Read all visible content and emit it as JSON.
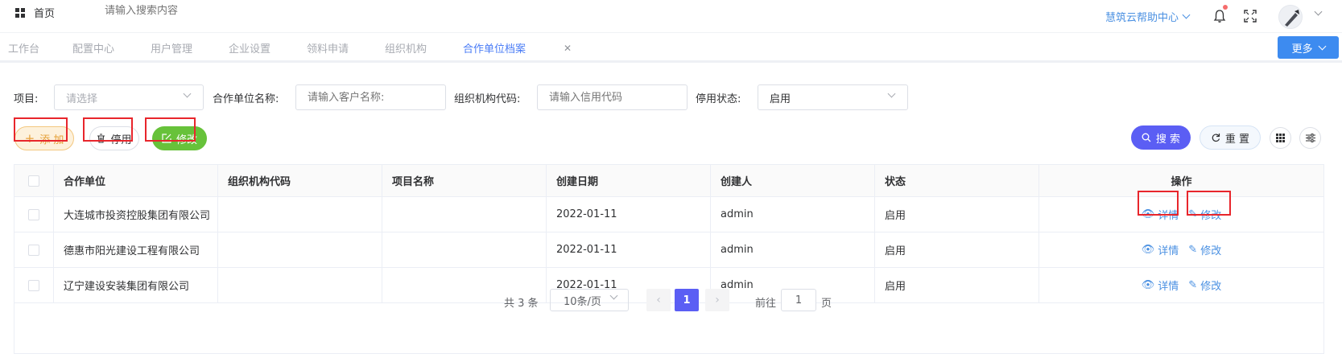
{
  "header": {
    "home_label": "首页",
    "search_placeholder": "请输入搜索内容",
    "help_center": "慧筑云帮助中心"
  },
  "tabs": [
    {
      "label": "工作台"
    },
    {
      "label": "配置中心"
    },
    {
      "label": "用户管理"
    },
    {
      "label": "企业设置"
    },
    {
      "label": "领料申请"
    },
    {
      "label": "组织机构"
    },
    {
      "label": "合作单位档案",
      "active": true
    }
  ],
  "more_label": "更多",
  "filters": {
    "project_label": "项目:",
    "project_placeholder": "请选择",
    "partner_label": "合作单位名称:",
    "partner_placeholder": "请输入客户名称:",
    "orgcode_label": "组织机构代码:",
    "orgcode_placeholder": "请输入信用代码",
    "status_label": "停用状态:",
    "status_value": "启用"
  },
  "actions": {
    "add": "添 加",
    "stop": "停用",
    "edit": "修改",
    "search": "搜 索",
    "reset": "重 置"
  },
  "table": {
    "columns": [
      "合作单位",
      "组织机构代码",
      "项目名称",
      "创建日期",
      "创建人",
      "状态",
      "操作"
    ],
    "rows": [
      {
        "partner": "大连城市投资控股集团有限公司",
        "orgcode": "",
        "project": "",
        "date": "2022-01-11",
        "creator": "admin",
        "status": "启用"
      },
      {
        "partner": "德惠市阳光建设工程有限公司",
        "orgcode": "",
        "project": "",
        "date": "2022-01-11",
        "creator": "admin",
        "status": "启用"
      },
      {
        "partner": "辽宁建设安装集团有限公司",
        "orgcode": "",
        "project": "",
        "date": "2022-01-11",
        "creator": "admin",
        "status": "启用"
      }
    ],
    "op_detail": "详情",
    "op_edit": "修改"
  },
  "pagination": {
    "total": "共 3 条",
    "page_size": "10条/页",
    "current": "1",
    "goto_label": "前往",
    "goto_value": "1",
    "unit": "页"
  },
  "colors": {
    "primary": "#5b5ef4",
    "link": "#4a90e2",
    "add": "#e6a23c",
    "edit": "#67c23a"
  }
}
